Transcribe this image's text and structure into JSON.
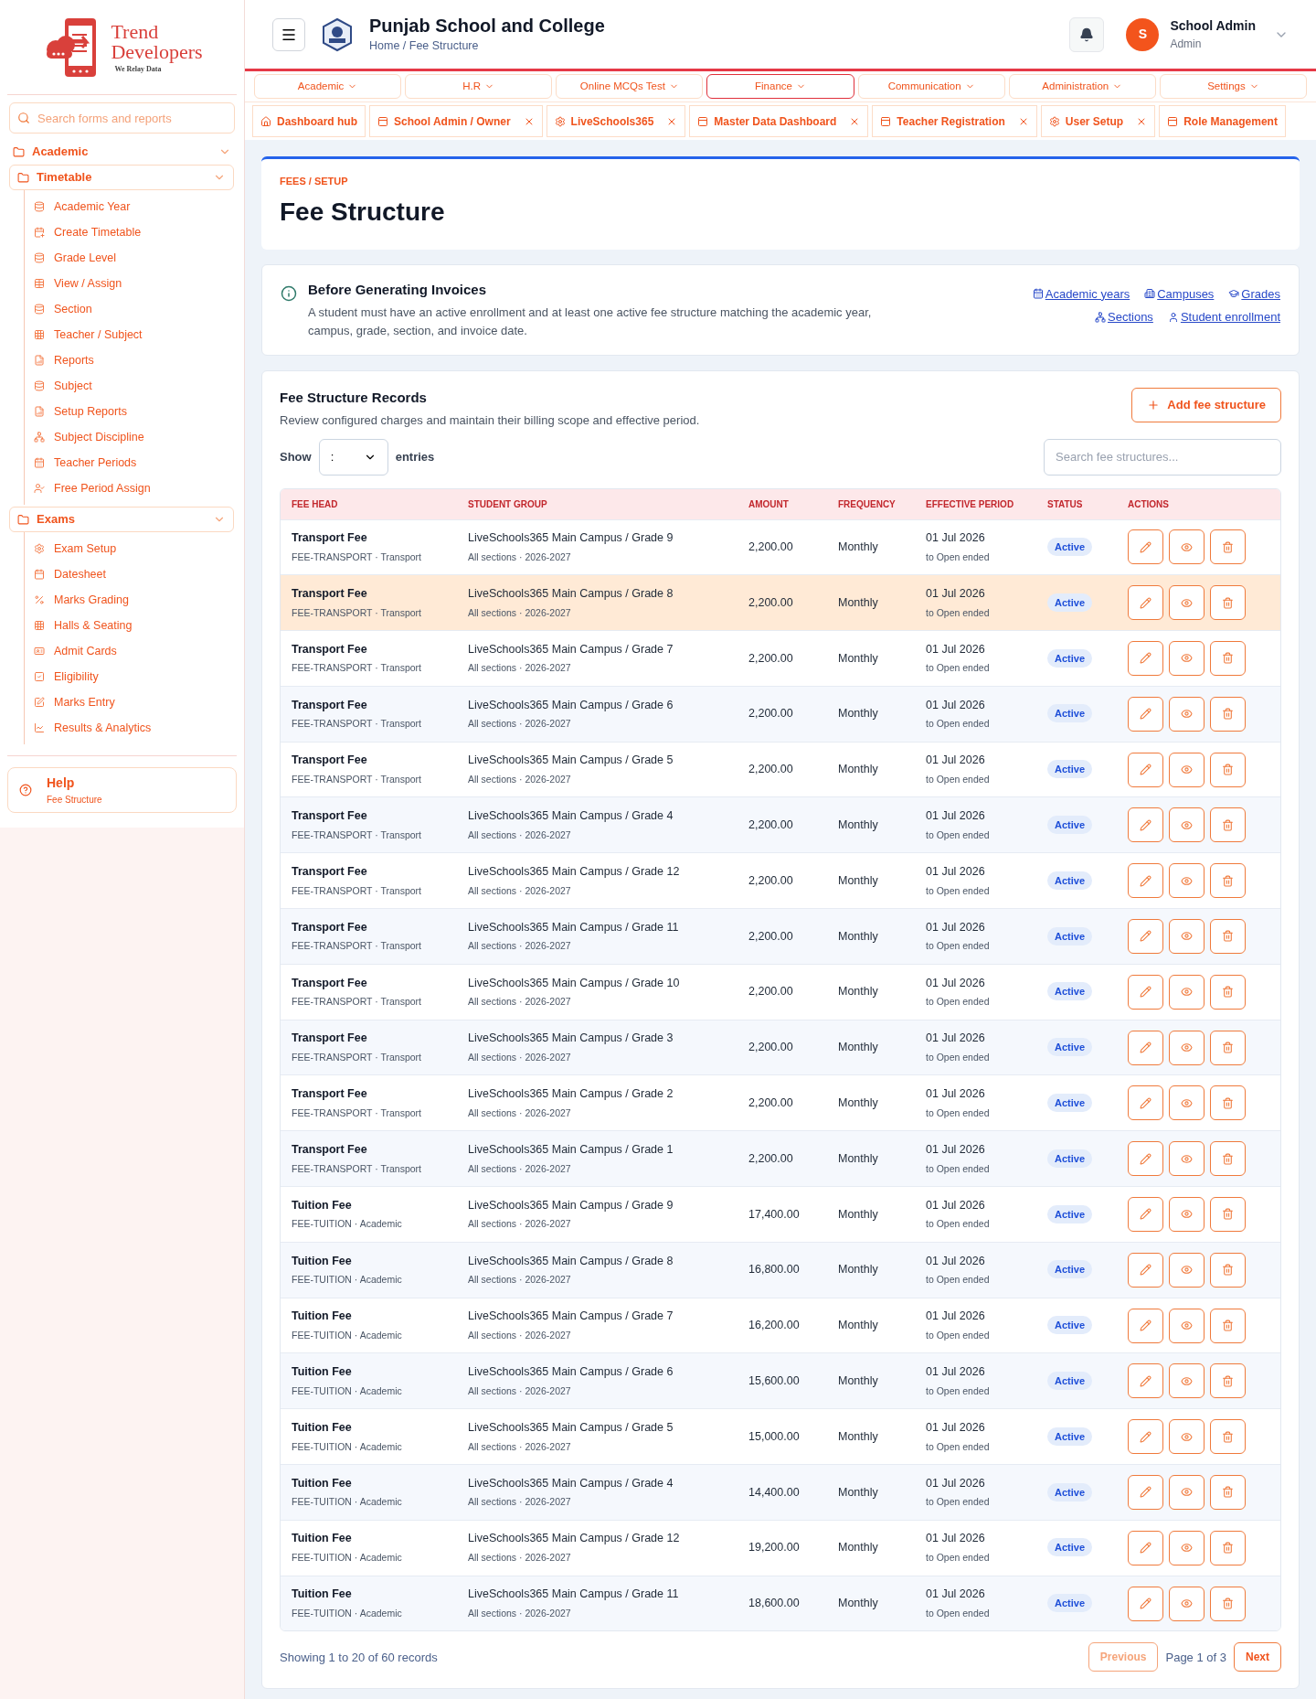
{
  "logo": {
    "name_line_1": "Trend",
    "name_line_2": "Developers",
    "tagline": "We Relay Data"
  },
  "sidebar": {
    "search": {
      "placeholder": "Search forms and reports"
    },
    "sections": [
      {
        "label": "Academic",
        "expanded": true,
        "groups": [
          {
            "label": "Timetable",
            "expanded": true,
            "children": [
              {
                "label": "Academic Year"
              },
              {
                "label": "Create Timetable"
              },
              {
                "label": "Grade Level"
              },
              {
                "label": "View / Assign"
              },
              {
                "label": "Section"
              },
              {
                "label": "Teacher / Subject"
              },
              {
                "label": "Reports"
              },
              {
                "label": "Subject"
              },
              {
                "label": "Setup Reports"
              },
              {
                "label": "Subject Discipline"
              },
              {
                "label": "Teacher Periods"
              },
              {
                "label": "Free Period Assign"
              }
            ]
          },
          {
            "label": "Exams",
            "expanded": true,
            "children": [
              {
                "label": "Exam Setup"
              },
              {
                "label": "Datesheet"
              },
              {
                "label": "Marks Grading"
              },
              {
                "label": "Halls & Seating"
              },
              {
                "label": "Admit Cards"
              },
              {
                "label": "Eligibility"
              },
              {
                "label": "Marks Entry"
              },
              {
                "label": "Results & Analytics"
              }
            ]
          }
        ]
      }
    ],
    "help": {
      "title": "Help",
      "subtitle": "Fee Structure"
    }
  },
  "header": {
    "school": "Punjab School and College",
    "breadcrumb": "Home / Fee Structure",
    "user": {
      "initial": "S",
      "name": "School Admin",
      "role": "Admin"
    }
  },
  "menu": [
    {
      "label": "Academic",
      "selected": false
    },
    {
      "label": "H.R",
      "selected": false
    },
    {
      "label": "Online MCQs Test",
      "selected": false
    },
    {
      "label": "Finance",
      "selected": true
    },
    {
      "label": "Communication",
      "selected": false
    },
    {
      "label": "Administration",
      "selected": false
    },
    {
      "label": "Settings",
      "selected": false
    }
  ],
  "tabs": [
    {
      "label": "Dashboard hub",
      "kind": "home",
      "closable": false
    },
    {
      "label": "School Admin / Owner",
      "kind": "page",
      "closable": true
    },
    {
      "label": "LiveSchools365",
      "kind": "settings",
      "closable": true
    },
    {
      "label": "Master Data Dashboard",
      "kind": "page",
      "closable": true
    },
    {
      "label": "Teacher Registration",
      "kind": "page",
      "closable": true
    },
    {
      "label": "User Setup",
      "kind": "settings",
      "closable": true
    },
    {
      "label": "Role Management",
      "kind": "page",
      "closable": false
    }
  ],
  "page": {
    "eyebrow": "FEES / SETUP",
    "title": "Fee Structure"
  },
  "notice": {
    "title": "Before Generating Invoices",
    "text": "A student must have an active enrollment and at least one active fee structure matching the academic year, campus, grade, section, and invoice date.",
    "links": [
      {
        "label": "Academic years",
        "kind": "calendar"
      },
      {
        "label": "Campuses",
        "kind": "building"
      },
      {
        "label": "Grades",
        "kind": "grad"
      },
      {
        "label": "Sections",
        "kind": "network"
      },
      {
        "label": "Student enrollment",
        "kind": "user"
      }
    ]
  },
  "records": {
    "title": "Fee Structure Records",
    "subtitle": "Review configured charges and maintain their billing scope and effective period.",
    "add_button": "Add fee structure",
    "show_label": "Show",
    "entries_value": ":",
    "entries_label": "entries",
    "search": {
      "placeholder": "Search fee structures..."
    },
    "columns": [
      "FEE HEAD",
      "STUDENT GROUP",
      "AMOUNT",
      "FREQUENCY",
      "EFFECTIVE PERIOD",
      "STATUS",
      "ACTIONS"
    ],
    "rows": [
      {
        "fee_head": "Transport Fee",
        "code": "FEE-TRANSPORT · Transport",
        "group": "LiveSchools365 Main Campus / Grade 9",
        "scope": "All sections · 2026-2027",
        "amount": "2,200.00",
        "frequency": "Monthly",
        "from": "01 Jul 2026",
        "to": "to Open ended",
        "status": "Active",
        "selected": false
      },
      {
        "fee_head": "Transport Fee",
        "code": "FEE-TRANSPORT · Transport",
        "group": "LiveSchools365 Main Campus / Grade 8",
        "scope": "All sections · 2026-2027",
        "amount": "2,200.00",
        "frequency": "Monthly",
        "from": "01 Jul 2026",
        "to": "to Open ended",
        "status": "Active",
        "selected": true
      },
      {
        "fee_head": "Transport Fee",
        "code": "FEE-TRANSPORT · Transport",
        "group": "LiveSchools365 Main Campus / Grade 7",
        "scope": "All sections · 2026-2027",
        "amount": "2,200.00",
        "frequency": "Monthly",
        "from": "01 Jul 2026",
        "to": "to Open ended",
        "status": "Active",
        "selected": false
      },
      {
        "fee_head": "Transport Fee",
        "code": "FEE-TRANSPORT · Transport",
        "group": "LiveSchools365 Main Campus / Grade 6",
        "scope": "All sections · 2026-2027",
        "amount": "2,200.00",
        "frequency": "Monthly",
        "from": "01 Jul 2026",
        "to": "to Open ended",
        "status": "Active",
        "selected": false
      },
      {
        "fee_head": "Transport Fee",
        "code": "FEE-TRANSPORT · Transport",
        "group": "LiveSchools365 Main Campus / Grade 5",
        "scope": "All sections · 2026-2027",
        "amount": "2,200.00",
        "frequency": "Monthly",
        "from": "01 Jul 2026",
        "to": "to Open ended",
        "status": "Active",
        "selected": false
      },
      {
        "fee_head": "Transport Fee",
        "code": "FEE-TRANSPORT · Transport",
        "group": "LiveSchools365 Main Campus / Grade 4",
        "scope": "All sections · 2026-2027",
        "amount": "2,200.00",
        "frequency": "Monthly",
        "from": "01 Jul 2026",
        "to": "to Open ended",
        "status": "Active",
        "selected": false
      },
      {
        "fee_head": "Transport Fee",
        "code": "FEE-TRANSPORT · Transport",
        "group": "LiveSchools365 Main Campus / Grade 12",
        "scope": "All sections · 2026-2027",
        "amount": "2,200.00",
        "frequency": "Monthly",
        "from": "01 Jul 2026",
        "to": "to Open ended",
        "status": "Active",
        "selected": false
      },
      {
        "fee_head": "Transport Fee",
        "code": "FEE-TRANSPORT · Transport",
        "group": "LiveSchools365 Main Campus / Grade 11",
        "scope": "All sections · 2026-2027",
        "amount": "2,200.00",
        "frequency": "Monthly",
        "from": "01 Jul 2026",
        "to": "to Open ended",
        "status": "Active",
        "selected": false
      },
      {
        "fee_head": "Transport Fee",
        "code": "FEE-TRANSPORT · Transport",
        "group": "LiveSchools365 Main Campus / Grade 10",
        "scope": "All sections · 2026-2027",
        "amount": "2,200.00",
        "frequency": "Monthly",
        "from": "01 Jul 2026",
        "to": "to Open ended",
        "status": "Active",
        "selected": false
      },
      {
        "fee_head": "Transport Fee",
        "code": "FEE-TRANSPORT · Transport",
        "group": "LiveSchools365 Main Campus / Grade 3",
        "scope": "All sections · 2026-2027",
        "amount": "2,200.00",
        "frequency": "Monthly",
        "from": "01 Jul 2026",
        "to": "to Open ended",
        "status": "Active",
        "selected": false
      },
      {
        "fee_head": "Transport Fee",
        "code": "FEE-TRANSPORT · Transport",
        "group": "LiveSchools365 Main Campus / Grade 2",
        "scope": "All sections · 2026-2027",
        "amount": "2,200.00",
        "frequency": "Monthly",
        "from": "01 Jul 2026",
        "to": "to Open ended",
        "status": "Active",
        "selected": false
      },
      {
        "fee_head": "Transport Fee",
        "code": "FEE-TRANSPORT · Transport",
        "group": "LiveSchools365 Main Campus / Grade 1",
        "scope": "All sections · 2026-2027",
        "amount": "2,200.00",
        "frequency": "Monthly",
        "from": "01 Jul 2026",
        "to": "to Open ended",
        "status": "Active",
        "selected": false
      },
      {
        "fee_head": "Tuition Fee",
        "code": "FEE-TUITION · Academic",
        "group": "LiveSchools365 Main Campus / Grade 9",
        "scope": "All sections · 2026-2027",
        "amount": "17,400.00",
        "frequency": "Monthly",
        "from": "01 Jul 2026",
        "to": "to Open ended",
        "status": "Active",
        "selected": false
      },
      {
        "fee_head": "Tuition Fee",
        "code": "FEE-TUITION · Academic",
        "group": "LiveSchools365 Main Campus / Grade 8",
        "scope": "All sections · 2026-2027",
        "amount": "16,800.00",
        "frequency": "Monthly",
        "from": "01 Jul 2026",
        "to": "to Open ended",
        "status": "Active",
        "selected": false
      },
      {
        "fee_head": "Tuition Fee",
        "code": "FEE-TUITION · Academic",
        "group": "LiveSchools365 Main Campus / Grade 7",
        "scope": "All sections · 2026-2027",
        "amount": "16,200.00",
        "frequency": "Monthly",
        "from": "01 Jul 2026",
        "to": "to Open ended",
        "status": "Active",
        "selected": false
      },
      {
        "fee_head": "Tuition Fee",
        "code": "FEE-TUITION · Academic",
        "group": "LiveSchools365 Main Campus / Grade 6",
        "scope": "All sections · 2026-2027",
        "amount": "15,600.00",
        "frequency": "Monthly",
        "from": "01 Jul 2026",
        "to": "to Open ended",
        "status": "Active",
        "selected": false
      },
      {
        "fee_head": "Tuition Fee",
        "code": "FEE-TUITION · Academic",
        "group": "LiveSchools365 Main Campus / Grade 5",
        "scope": "All sections · 2026-2027",
        "amount": "15,000.00",
        "frequency": "Monthly",
        "from": "01 Jul 2026",
        "to": "to Open ended",
        "status": "Active",
        "selected": false
      },
      {
        "fee_head": "Tuition Fee",
        "code": "FEE-TUITION · Academic",
        "group": "LiveSchools365 Main Campus / Grade 4",
        "scope": "All sections · 2026-2027",
        "amount": "14,400.00",
        "frequency": "Monthly",
        "from": "01 Jul 2026",
        "to": "to Open ended",
        "status": "Active",
        "selected": false
      },
      {
        "fee_head": "Tuition Fee",
        "code": "FEE-TUITION · Academic",
        "group": "LiveSchools365 Main Campus / Grade 12",
        "scope": "All sections · 2026-2027",
        "amount": "19,200.00",
        "frequency": "Monthly",
        "from": "01 Jul 2026",
        "to": "to Open ended",
        "status": "Active",
        "selected": false
      },
      {
        "fee_head": "Tuition Fee",
        "code": "FEE-TUITION · Academic",
        "group": "LiveSchools365 Main Campus / Grade 11",
        "scope": "All sections · 2026-2027",
        "amount": "18,600.00",
        "frequency": "Monthly",
        "from": "01 Jul 2026",
        "to": "to Open ended",
        "status": "Active",
        "selected": false
      }
    ],
    "summary": "Showing 1 to 20 of 60 records",
    "pagination": {
      "previous": "Previous",
      "page": "Page 1 of 3",
      "next": "Next"
    }
  }
}
